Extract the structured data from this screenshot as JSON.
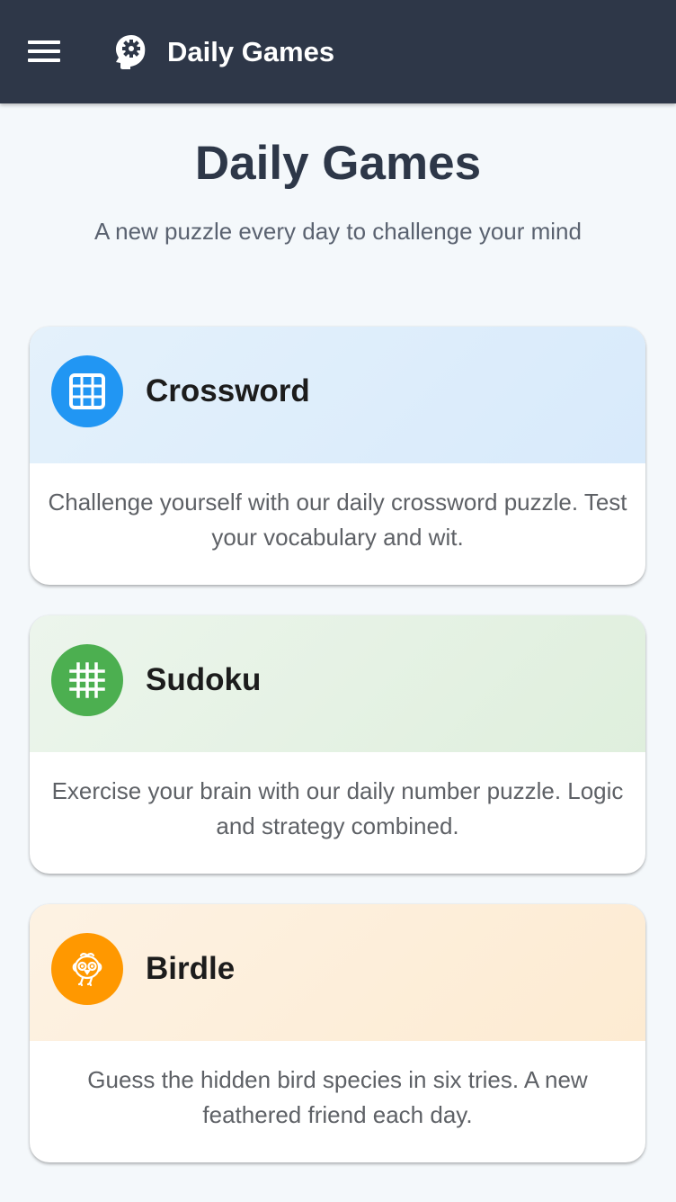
{
  "header": {
    "brand_title": "Daily Games",
    "menu_icon": "hamburger-menu-icon",
    "brand_icon": "head-gear-icon",
    "background": "#2e3748"
  },
  "hero": {
    "title": "Daily Games",
    "subtitle": "A new puzzle every day to challenge your mind"
  },
  "games": [
    {
      "title": "Crossword",
      "description": "Challenge yourself with our daily crossword puzzle. Test your vocabulary and wit.",
      "icon": "grid-icon",
      "icon_color": "#2196f3",
      "header_gradient": [
        "#e4f1fb",
        "#d8eafb"
      ]
    },
    {
      "title": "Sudoku",
      "description": "Exercise your brain with our daily number puzzle. Logic and strategy combined.",
      "icon": "hashtag-grid-icon",
      "icon_color": "#4caf50",
      "header_gradient": [
        "#ecf5ec",
        "#dfefdd"
      ]
    },
    {
      "title": "Birdle",
      "description": "Guess the hidden bird species in six tries. A new feathered friend each day.",
      "icon": "bird-icon",
      "icon_color": "#ff9800",
      "header_gradient": [
        "#fdf2e3",
        "#fdebd2"
      ]
    }
  ]
}
